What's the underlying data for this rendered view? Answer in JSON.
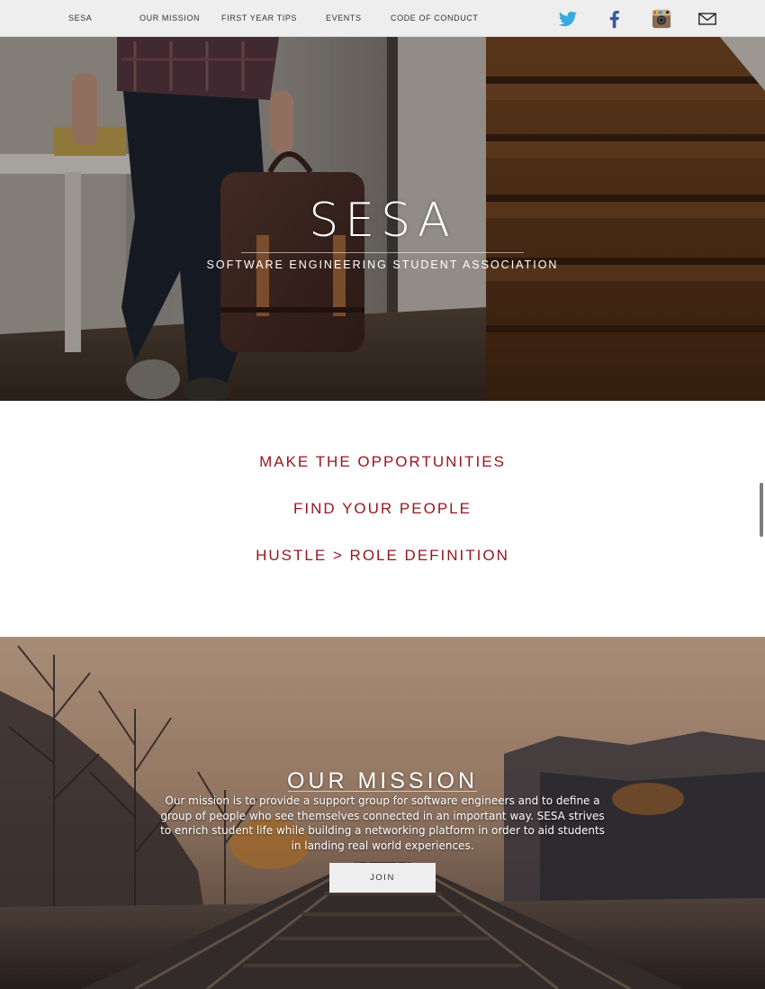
{
  "nav": {
    "links": [
      "SESA",
      "OUR MISSION",
      "FIRST YEAR TIPS",
      "EVENTS",
      "CODE OF CONDUCT"
    ],
    "social_icons": [
      "twitter-icon",
      "facebook-icon",
      "instagram-icon",
      "mail-icon"
    ]
  },
  "hero": {
    "title": "SESA",
    "subtitle": "SOFTWARE ENGINEERING STUDENT ASSOCIATION"
  },
  "taglines": [
    "MAKE THE OPPORTUNITIES",
    "FIND YOUR PEOPLE",
    "HUSTLE > ROLE DEFINITION"
  ],
  "mission": {
    "title": "OUR MISSION",
    "body": "Our mission is to provide a support group for software engineers and to define a group of people who see themselves connected in an important way. SESA strives to enrich student life while building a networking platform in order to aid students in landing real world experiences.",
    "button_label": "JOIN"
  },
  "colors": {
    "accent": "#97161c",
    "nav_background": "#eeeeee",
    "twitter": "#39a9e0",
    "facebook": "#3b5998"
  }
}
